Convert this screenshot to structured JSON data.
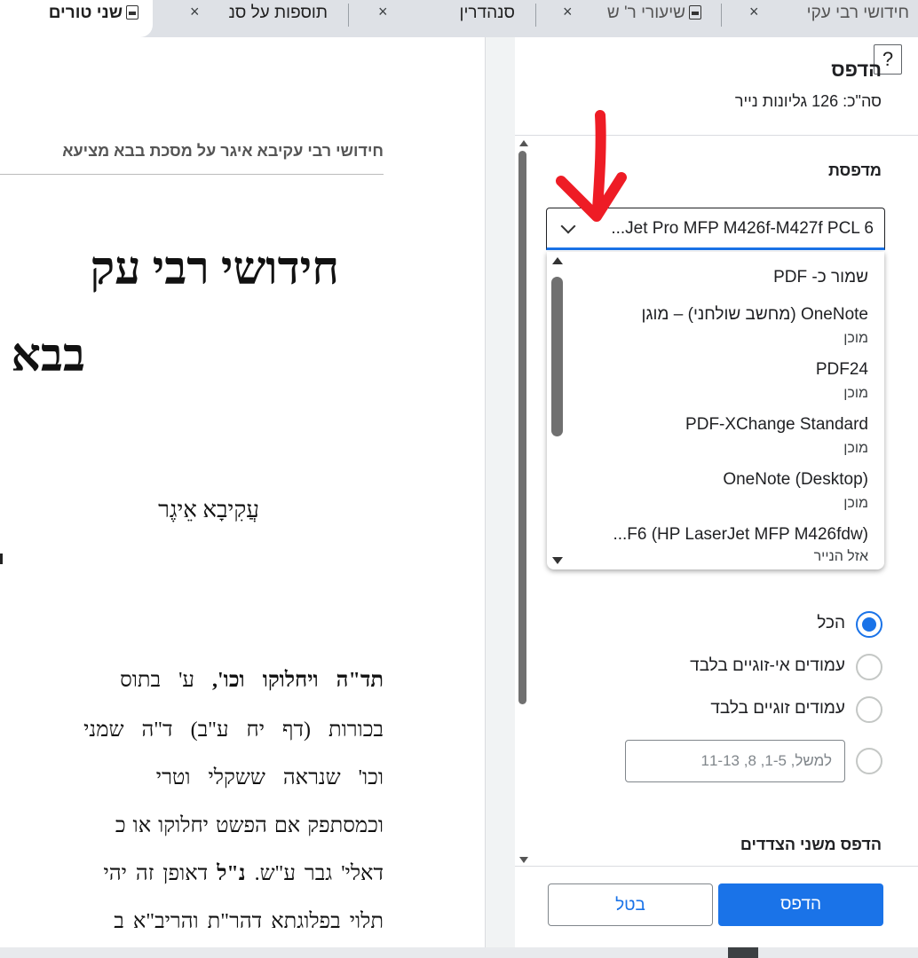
{
  "tabs": [
    {
      "label": "שני טורים",
      "close": "×",
      "icon": "pdf-file-icon",
      "active": true
    },
    {
      "label": "תוספות על סנ",
      "close": "×"
    },
    {
      "label": "סנהדרין",
      "close": "×"
    },
    {
      "label": "שיעורי ר' ש",
      "close": "×",
      "icon": "pdf-file-icon"
    },
    {
      "label": "חידושי רבי עקי",
      "close": "×"
    }
  ],
  "document": {
    "running_head": "חידושי רבי עקיבא איגר על מסכת בבא מציעא",
    "title_line1": "חידושי רבי עק",
    "title_line2": "בבא",
    "author": "עֲקִיבָא אֵיגֶר",
    "body_lines": [
      {
        "bold": "תד\"ה ויחלוקו וכו',",
        "text": " ע' בתוס"
      },
      {
        "bold": "",
        "text": "בכורות (דף יח ע\"ב) ד\"ה שמני"
      },
      {
        "bold": "",
        "text": "וכו' שנראה ששקלי וטרי"
      },
      {
        "bold": "",
        "text": "וכמסתפק אם הפשט יחלוקו או כ"
      },
      {
        "bold": "",
        "text": "דאלי' גבר ע\"ש. ",
        "bold2": "נ\"ל",
        "text2": " דאופן זה יהי"
      },
      {
        "bold": "",
        "text": "תלוי בפלוגתא דהר\"ת והריב\"א ב"
      }
    ]
  },
  "print_dialog": {
    "help": "?",
    "title": "הדפס",
    "sheets": "סה\"כ: 126 גליונות נייר",
    "printer_label": "מדפסת",
    "selected_printer": "...Jet Pro MFP M426f-M427f PCL 6",
    "printer_options": [
      {
        "name": "שמור כ- PDF",
        "status": ""
      },
      {
        "name": "OneNote (מחשב שולחני) – מוגן",
        "status": "מוכן"
      },
      {
        "name": "PDF24",
        "status": "מוכן"
      },
      {
        "name": "PDF-XChange Standard",
        "status": "מוכן"
      },
      {
        "name": "OneNote (Desktop)",
        "status": "מוכן"
      },
      {
        "name": "...F6 (HP LaserJet MFP M426fdw)",
        "status": "אזל הנייר"
      }
    ],
    "pages_options": [
      {
        "label": "הכל",
        "selected": true
      },
      {
        "label": "עמודים אי-זוגיים בלבד",
        "selected": false
      },
      {
        "label": "עמודים זוגיים בלבד",
        "selected": false
      }
    ],
    "custom_range_placeholder": "למשל, 1-5, 8, 11-13",
    "duplex_label": "הדפס משני הצדדים",
    "print_button": "הדפס",
    "cancel_button": "בטל"
  },
  "colors": {
    "accent": "#1a73e8",
    "annotation_arrow": "#ee1c25"
  }
}
